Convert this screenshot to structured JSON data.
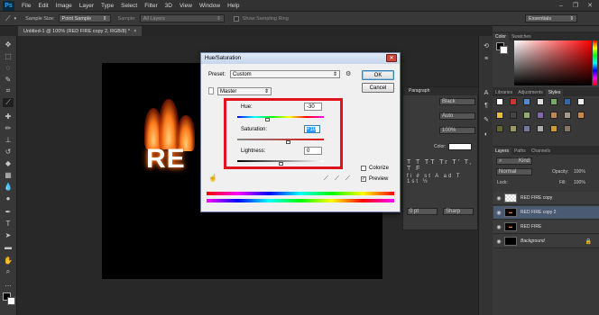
{
  "app": {
    "logo": "Ps"
  },
  "menu": [
    "File",
    "Edit",
    "Image",
    "Layer",
    "Type",
    "Select",
    "Filter",
    "3D",
    "View",
    "Window",
    "Help"
  ],
  "options": {
    "sample_size_label": "Sample Size:",
    "sample_size_value": "Point Sample",
    "sample_label": "Sample:",
    "sample_value": "All Layers",
    "show_ring_label": "Show Sampling Ring",
    "workspace": "Essentials"
  },
  "document": {
    "tab_title": "Untitled-1 @ 100% (RED FIRE copy 2, RGB/8) *",
    "canvas_text": "RE"
  },
  "panels": {
    "color_tabs": [
      "Color",
      "Swatches"
    ],
    "styles_tabs": [
      "Libraries",
      "Adjustments",
      "Styles"
    ],
    "character_tab": "Paragraph",
    "character_color_label": "Color:",
    "character_values": [
      "Black",
      "Auto",
      "100%",
      "100%",
      "0 pt",
      "Sharp"
    ],
    "layers_tabs": [
      "Layers",
      "Paths",
      "Channels"
    ],
    "kind_label": "Kind",
    "blend_mode": "Normal",
    "opacity_label": "Opacity:",
    "opacity_value": "100%",
    "lock_label": "Lock:",
    "fill_label": "Fill:",
    "fill_value": "100%",
    "layers": [
      {
        "name": "RED FIRE copy",
        "selected": false
      },
      {
        "name": "RED FIRE copy 2",
        "selected": true
      },
      {
        "name": "RED FIRE",
        "selected": false
      },
      {
        "name": "Background",
        "selected": false
      }
    ]
  },
  "dialog": {
    "title": "Hue/Saturation",
    "preset_label": "Preset:",
    "preset_value": "Custom",
    "channel_value": "Master",
    "hue_label": "Hue:",
    "hue_value": "-30",
    "saturation_label": "Saturation:",
    "saturation_value": "+10",
    "lightness_label": "Lightness:",
    "lightness_value": "0",
    "ok_label": "OK",
    "cancel_label": "Cancel",
    "colorize_label": "Colorize",
    "preview_label": "Preview",
    "preview_checked": true,
    "colorize_checked": false
  },
  "colors": {
    "highlight": "#e0121b",
    "ps_blue": "#31a8ff"
  }
}
